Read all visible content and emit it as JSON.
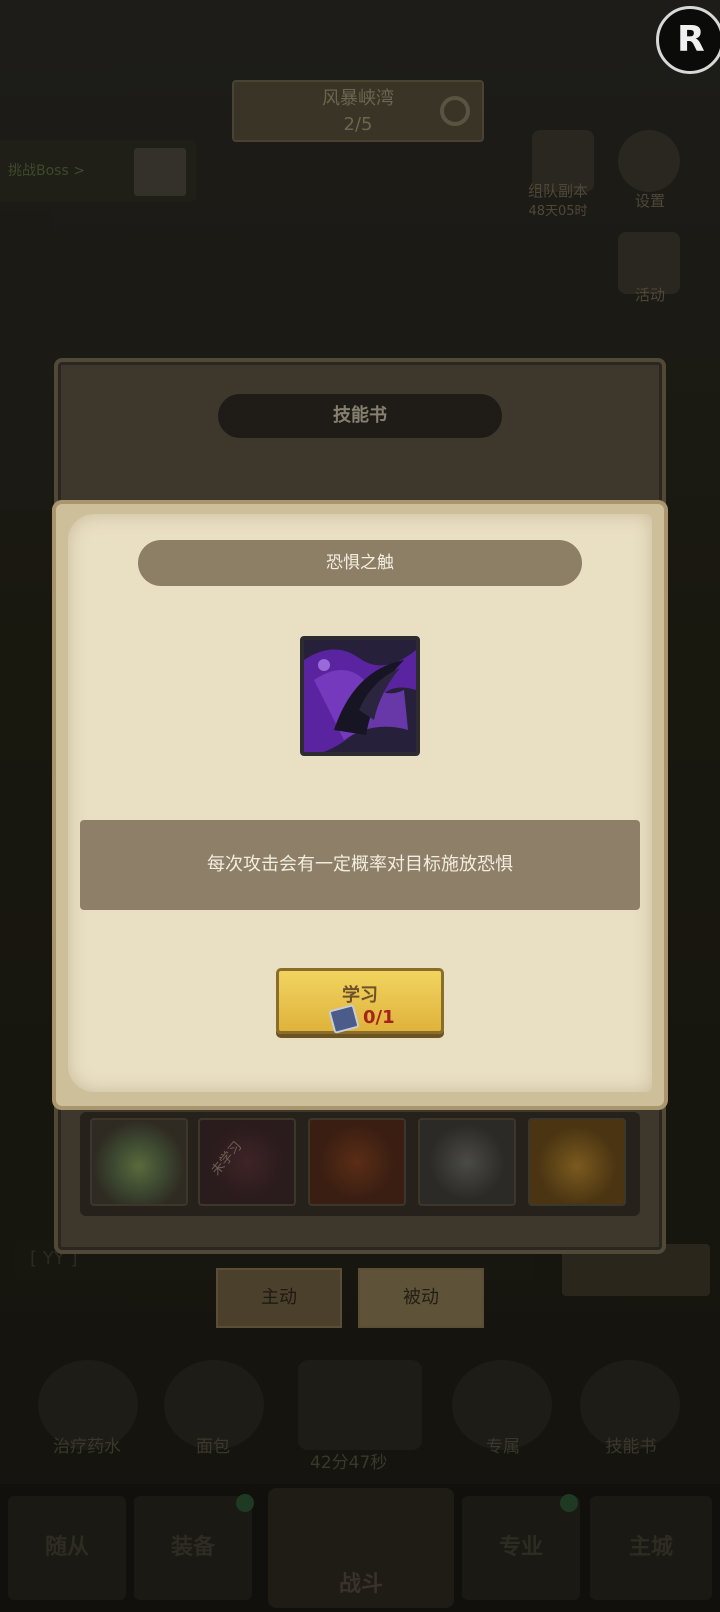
{
  "background": {
    "stage": {
      "name": "风暴峡湾",
      "progress": "2/5"
    },
    "challenge_label": "挑战Boss >",
    "right_menu": [
      {
        "label": "组队副本",
        "sub": "48天05时"
      },
      {
        "label": "设置"
      },
      {
        "label": "活动"
      }
    ],
    "profile_badge": "R",
    "shelf_text": "[ YY ]",
    "tabs": [
      "主动",
      "被动"
    ],
    "items": [
      "治疗药水",
      "面包",
      "专属",
      "技能书"
    ],
    "timer": "42分47秒",
    "nav": [
      "随从",
      "装备",
      "战斗",
      "专业",
      "主城"
    ]
  },
  "skill_book_panel": {
    "title": "技能书",
    "unlearned_tag": "未学习"
  },
  "skill_dialog": {
    "title": "恐惧之触",
    "description": "每次攻击会有一定概率对目标施放恐惧",
    "learn_button": {
      "label": "学习",
      "count": "0/1"
    }
  },
  "colors": {
    "dialog_bg": "#e9dfc3",
    "title_bar": "#8d7e66",
    "button_gold": "#e8c24c",
    "count_red": "#a5231b",
    "skill_icon_purple": "#6b2fb2"
  }
}
